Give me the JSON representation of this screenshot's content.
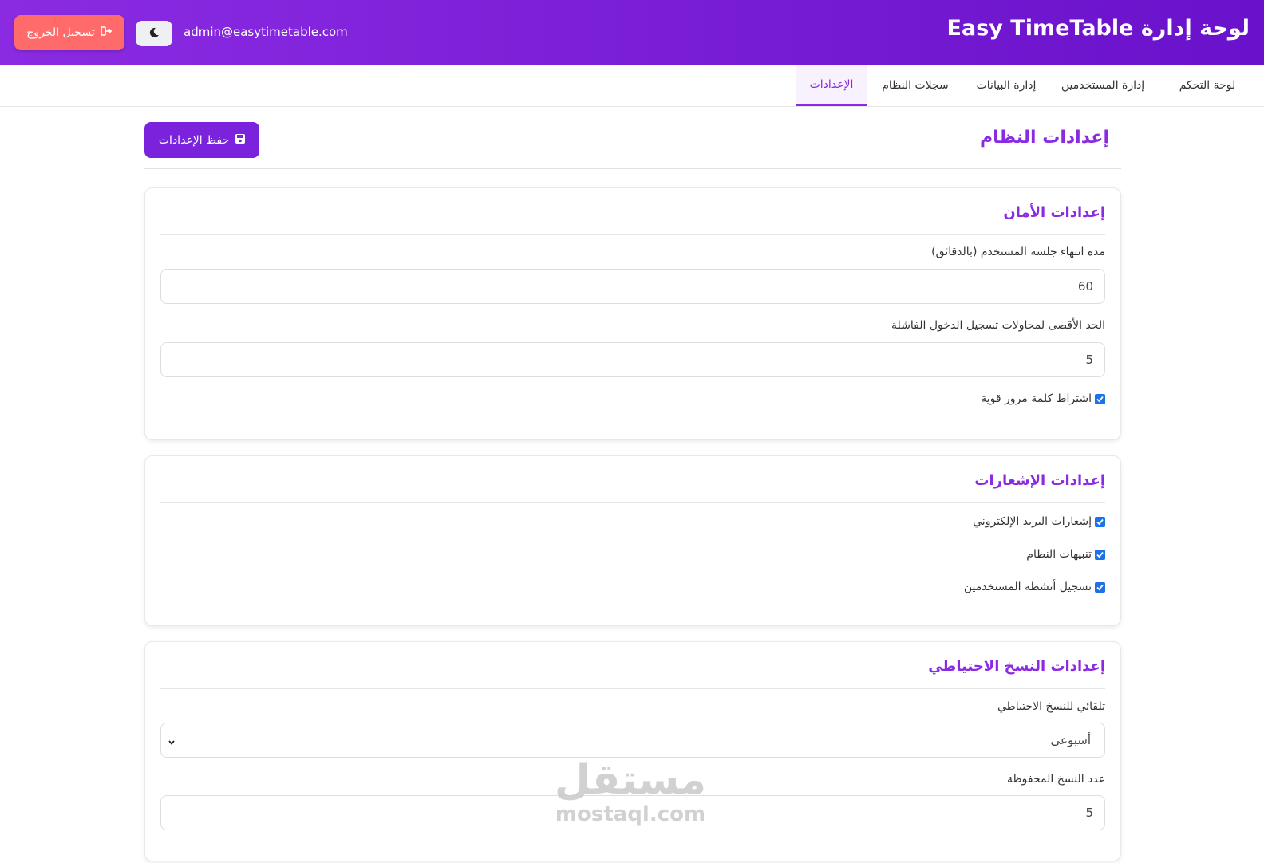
{
  "header": {
    "brand": "لوحة إدارة Easy TimeTable",
    "user_email": "admin@easytimetable.com",
    "logout_label": "تسجيل الخروج",
    "theme_icon": "moon-icon",
    "logout_icon": "sign-out-icon",
    "gradient": [
      "#8a2be2",
      "#6a11cb"
    ]
  },
  "nav": {
    "items": [
      {
        "label": "لوحة التحكم",
        "active": false
      },
      {
        "label": "إدارة المستخدمين",
        "active": false
      },
      {
        "label": "إدارة البيانات",
        "active": false
      },
      {
        "label": "سجلات النظام",
        "active": false
      },
      {
        "label": "الإعدادات",
        "active": true
      }
    ]
  },
  "page": {
    "title": "إعدادات النظام",
    "save_label": "حفظ الإعدادات",
    "save_icon": "save-icon",
    "accent": "#8a2be2"
  },
  "security": {
    "title": "إعدادات الأمان",
    "session_label": "مدة انتهاء جلسة المستخدم (بالدقائق)",
    "session_value": "60",
    "attempts_label": "الحد الأقصى لمحاولات تسجيل الدخول الفاشلة",
    "attempts_value": "5",
    "strong_password_label": "اشتراط كلمة مرور قوية",
    "strong_password_checked": true
  },
  "notifications": {
    "title": "إعدادات الإشعارات",
    "email_label": "إشعارات البريد الإلكتروني",
    "email_checked": true,
    "system_alerts_label": "تنبيهات النظام",
    "system_alerts_checked": true,
    "activity_log_label": "تسجيل أنشطة المستخدمين",
    "activity_log_checked": true
  },
  "backup": {
    "title": "إعدادات النسخ الاحتياطي",
    "auto_label": "تلقائي للنسخ الاحتياطي",
    "auto_value": "أسبوعى",
    "count_label": "عدد النسخ المحفوظة",
    "count_value": "5"
  },
  "watermark": {
    "arabic": "مستقل",
    "latin": "mostaql.com"
  }
}
